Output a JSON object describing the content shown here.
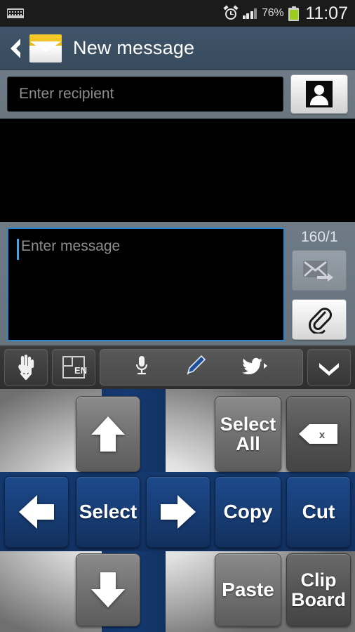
{
  "status_bar": {
    "keyboard_icon": "keyboard-icon",
    "alarm_icon": "alarm-clock-icon",
    "signal_icon": "signal-bars-icon",
    "battery_percent": "76%",
    "battery_icon": "battery-icon",
    "time": "11:07"
  },
  "action_bar": {
    "back_icon": "back-chevron-icon",
    "app_icon": "envelope-icon",
    "title": "New message"
  },
  "recipient": {
    "placeholder": "Enter recipient",
    "value": "",
    "contacts_button_icon": "contact-person-icon"
  },
  "compose": {
    "placeholder": "Enter message",
    "value": "",
    "char_counter": "160/1",
    "send_button_icon": "send-message-icon",
    "send_button_enabled": false,
    "attach_button_icon": "paperclip-icon"
  },
  "keyboard_toolbar": {
    "handwriting_icon": "hand-write-icon",
    "language_key_label": "EN",
    "language_icon": "keyboard-layout-icon",
    "voice_icon": "microphone-icon",
    "pen_icon": "pencil-icon",
    "twitter_icon": "twitter-bird-icon",
    "collapse_icon": "chevron-down-icon"
  },
  "keyboard": {
    "highlight_color": "#143a74",
    "rows": [
      [
        {
          "name": "arrow-up-key",
          "label": "",
          "icon": "arrow-up-icon",
          "style": "grey"
        },
        {
          "name": "select-all-key",
          "label": "Select All",
          "icon": "",
          "style": "grey"
        },
        {
          "name": "backspace-key",
          "label": "",
          "icon": "backspace-icon",
          "style": "greyd"
        }
      ],
      [
        {
          "name": "arrow-left-key",
          "label": "",
          "icon": "arrow-left-icon",
          "style": "blue"
        },
        {
          "name": "select-key",
          "label": "Select",
          "icon": "",
          "style": "blue"
        },
        {
          "name": "arrow-right-key",
          "label": "",
          "icon": "arrow-right-icon",
          "style": "blue"
        },
        {
          "name": "copy-key",
          "label": "Copy",
          "icon": "",
          "style": "blue"
        },
        {
          "name": "cut-key",
          "label": "Cut",
          "icon": "",
          "style": "blue"
        }
      ],
      [
        {
          "name": "arrow-down-key",
          "label": "",
          "icon": "arrow-down-icon",
          "style": "grey"
        },
        {
          "name": "paste-key",
          "label": "Paste",
          "icon": "",
          "style": "grey"
        },
        {
          "name": "clipboard-key",
          "label": "Clip Board",
          "icon": "",
          "style": "greyd"
        }
      ]
    ],
    "labels": {
      "select_all": "Select All",
      "select_all_line1": "Select",
      "select_all_line2": "All",
      "select": "Select",
      "copy": "Copy",
      "cut": "Cut",
      "paste": "Paste",
      "clipboard_line1": "Clip",
      "clipboard_line2": "Board"
    }
  },
  "colors": {
    "action_bar": "#3b4f63",
    "panel": "#6e7b87",
    "field_bg": "#000000",
    "field_focus_border": "#2f85c9",
    "key_blue": "#143a74",
    "battery_green": "#9ccc20"
  }
}
